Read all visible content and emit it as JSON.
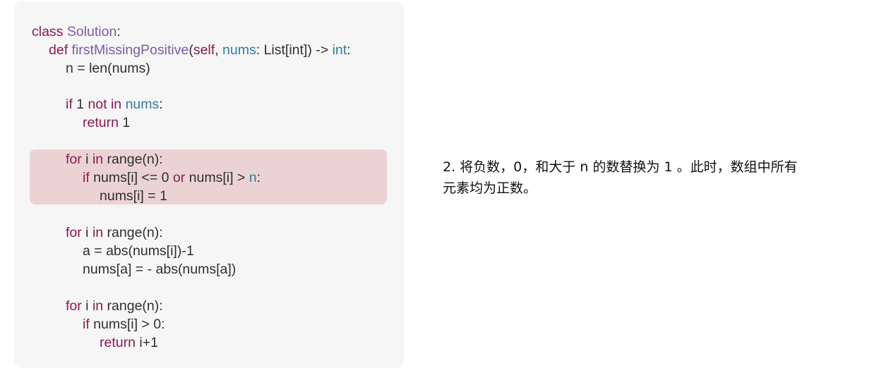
{
  "code": {
    "l1": {
      "kw": "class",
      "name": "Solution",
      "punct": ":"
    },
    "l2": {
      "kw": "def",
      "fn": "firstMissingPositive",
      "open": "(",
      "self": "self",
      "comma": ", ",
      "param": "nums",
      "colon": ": ",
      "type": "List[int]",
      "close": ") -> ",
      "ret": "int",
      "end": ":"
    },
    "l3": {
      "text": "n = len(nums)"
    },
    "l4": {
      "kw": "if",
      "num": " 1 ",
      "kw2": "not in",
      "space": " ",
      "var": "nums",
      "colon": ":"
    },
    "l5": {
      "kw": "return",
      "num": " 1"
    },
    "l6": {
      "kw": "for",
      "var": " i ",
      "kw2": "in",
      "rest": " range(n):"
    },
    "l7": {
      "kw": "if",
      "cond1": " nums[i] <= 0 ",
      "kw2": "or",
      "cond2": " nums[i] > ",
      "var": "n",
      "colon": ":"
    },
    "l8": {
      "text": "nums[i] = 1"
    },
    "l9": {
      "kw": "for",
      "var": " i ",
      "kw2": "in",
      "rest": " range(n):"
    },
    "l10": {
      "text": "a = abs(nums[i])-1"
    },
    "l11": {
      "text": "nums[a] = - abs(nums[a])"
    },
    "l12": {
      "kw": "for",
      "var": " i ",
      "kw2": "in",
      "rest": " range(n):"
    },
    "l13": {
      "kw": "if",
      "rest": " nums[i] > 0:"
    },
    "l14": {
      "kw": "return",
      "rest": " i+1"
    }
  },
  "explanation": {
    "line1": "2. 将负数，0，和大于 n 的数替换为 1 。此时，数组中所有",
    "line2": "元素均为正数。"
  },
  "colors": {
    "panel_bg": "#f6f6f6",
    "highlight_bg": "#ecd3d3",
    "keyword": "#8a1a55",
    "class_name": "#7e5aa6",
    "type": "#2d7f9e"
  }
}
